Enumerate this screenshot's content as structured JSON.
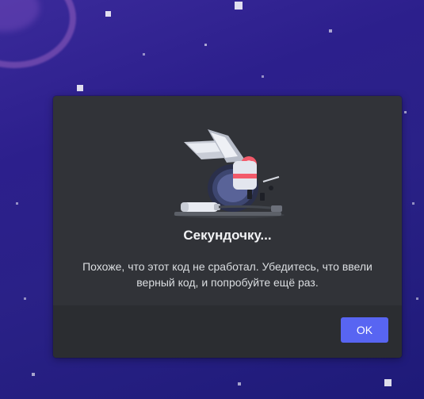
{
  "dialog": {
    "title": "Секундочку...",
    "message": "Похоже, что этот код не сработал. Убедитесь, что ввели верный код, и попробуйте ещё раз.",
    "illustration": "broken-robot-illustration",
    "ok_label": "OK"
  },
  "colors": {
    "dialog_bg": "#313338",
    "footer_bg": "#2b2d31",
    "accent": "#5865f2",
    "title_text": "#f2f3f5",
    "body_text": "#dbdee1"
  }
}
